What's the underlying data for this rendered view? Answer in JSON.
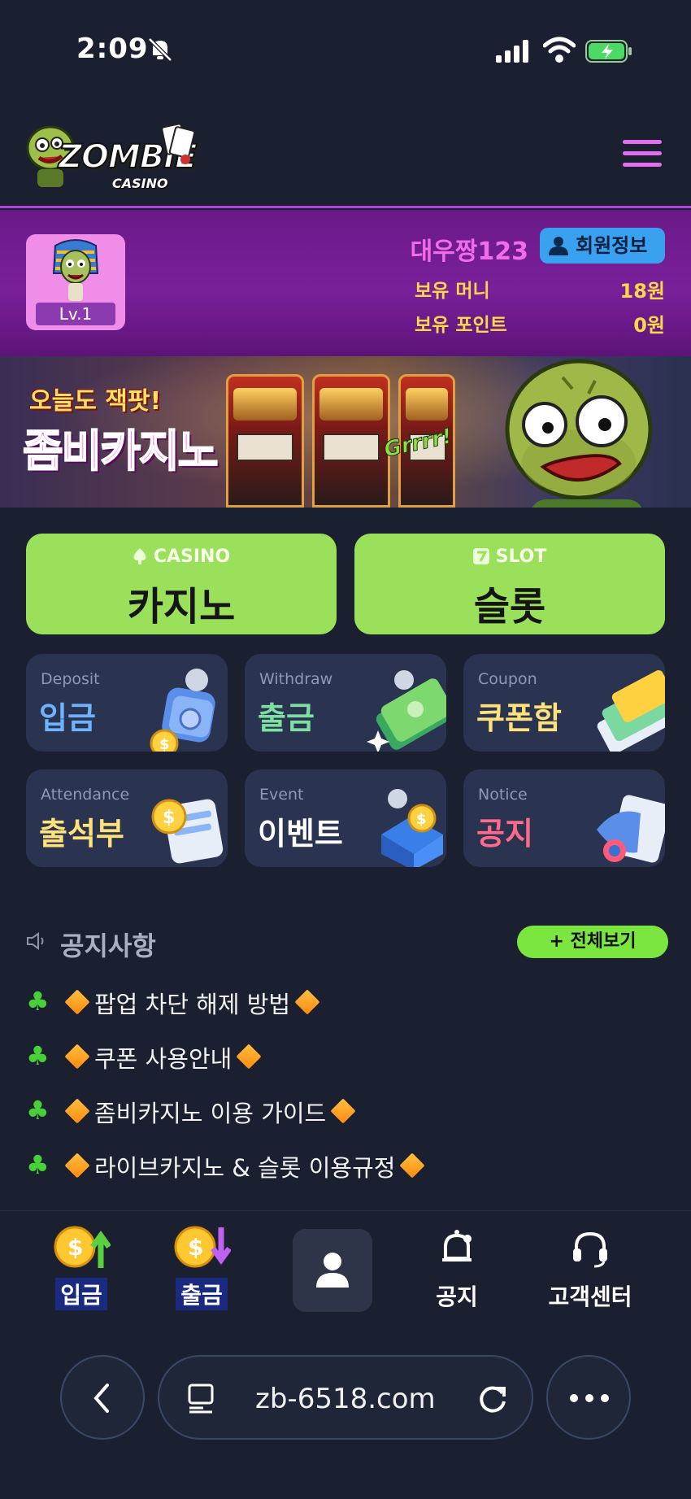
{
  "status_bar": {
    "time": "2:09"
  },
  "header": {
    "logo_text": "ZOMBIE",
    "logo_sub": "CASINO"
  },
  "profile": {
    "level": "Lv.1",
    "username": "대우짱123",
    "member_info_label": "회원정보",
    "money_label": "보유 머니",
    "money_value": "18원",
    "points_label": "보유 포인트",
    "points_value": "0원"
  },
  "banner": {
    "subtitle": "오늘도 잭팟!",
    "title": "좀비카지노",
    "exclaim": "Grrrr!"
  },
  "categories": [
    {
      "sub": "CASINO",
      "main": "카지노"
    },
    {
      "sub": "SLOT",
      "main": "슬롯"
    }
  ],
  "tiles": [
    {
      "en": "Deposit",
      "ko": "입금",
      "color": "#6cb4ff"
    },
    {
      "en": "Withdraw",
      "ko": "출금",
      "color": "#7ee0a0"
    },
    {
      "en": "Coupon",
      "ko": "쿠폰함",
      "color": "#ffe27a"
    },
    {
      "en": "Attendance",
      "ko": "출석부",
      "color": "#ffe27a"
    },
    {
      "en": "Event",
      "ko": "이벤트",
      "color": "#ffffff"
    },
    {
      "en": "Notice",
      "ko": "공지",
      "color": "#ff6a8a"
    }
  ],
  "notices": {
    "title": "공지사항",
    "see_all": "+ 전체보기",
    "items": [
      "팝업 차단 해제 방법",
      "쿠폰 사용안내",
      "좀비카지노 이용 가이드",
      "라이브카지노 & 슬롯 이용규정"
    ]
  },
  "bottom_nav": {
    "deposit": "입금",
    "withdraw": "출금",
    "notice": "공지",
    "support": "고객센터"
  },
  "browser": {
    "url": "zb-6518.com"
  },
  "colors": {
    "accent_purple": "#b040e0",
    "profile_bg": "#7a1f9a",
    "green_button": "#9be05a",
    "tile_bg": "#2a3350",
    "page_bg": "#1b2030"
  }
}
